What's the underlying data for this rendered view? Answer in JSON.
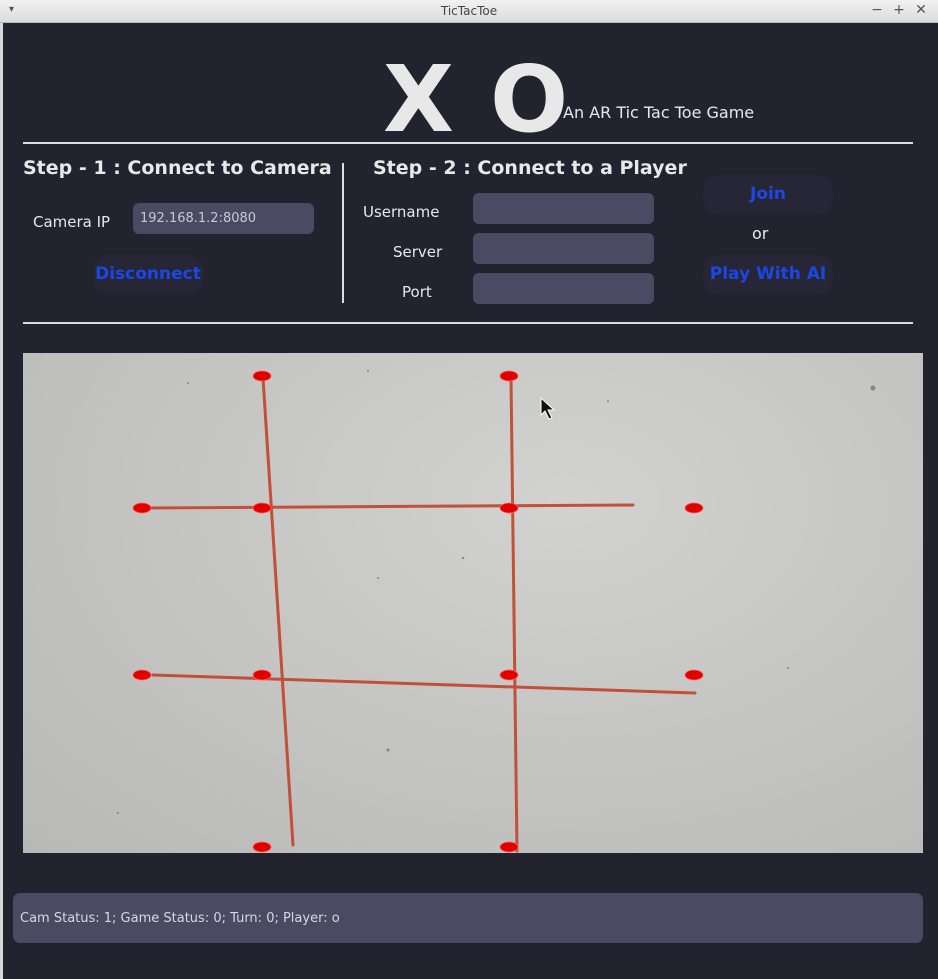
{
  "window": {
    "title": "TicTacToe",
    "menu_glyph": "▾",
    "minimize_glyph": "−",
    "maximize_glyph": "+",
    "close_glyph": "✕"
  },
  "header": {
    "logo": "X O",
    "subtitle": "An AR Tic Tac Toe Game"
  },
  "step1": {
    "title": "Step - 1 : Connect to Camera",
    "camera_ip_label": "Camera IP",
    "camera_ip_value": "192.168.1.2:8080",
    "disconnect_label": "Disconnect"
  },
  "step2": {
    "title": "Step - 2 : Connect to a Player",
    "username_label": "Username",
    "username_value": "",
    "server_label": "Server",
    "server_value": "",
    "port_label": "Port",
    "port_value": "",
    "join_label": "Join",
    "or_label": "or",
    "play_ai_label": "Play With AI"
  },
  "status": {
    "text": "Cam Status: 1;  Game Status: 0;  Turn: 0;  Player: o"
  },
  "colors": {
    "background": "#23232f",
    "button_text": "#1a47e6",
    "field_bg": "#4a4a62",
    "marker_red": "#e00000",
    "grid_line": "#c0442a"
  }
}
